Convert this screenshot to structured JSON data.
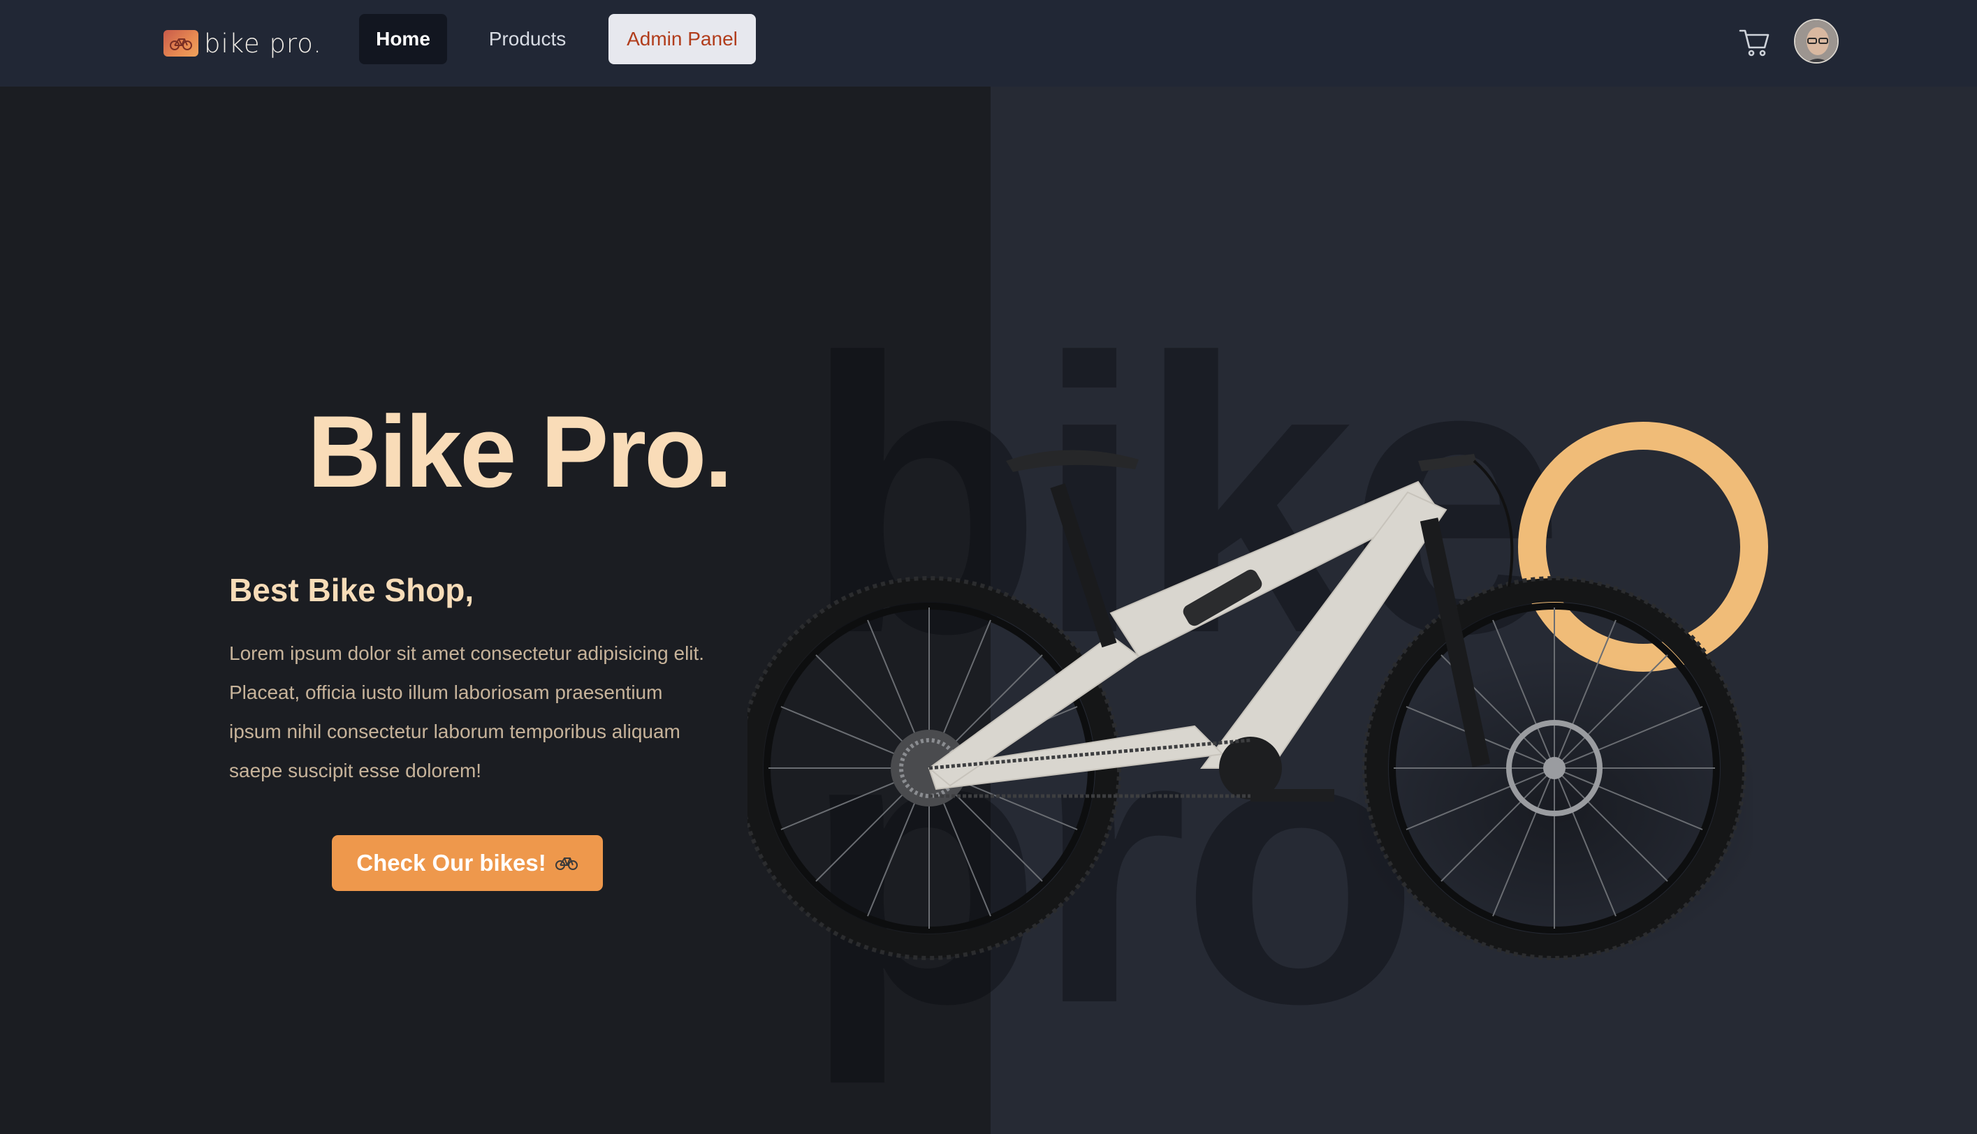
{
  "brand": {
    "name": "bike pro.",
    "logo_icon": "bicycle-icon"
  },
  "nav": {
    "home": "Home",
    "products": "Products",
    "admin": "Admin Panel"
  },
  "header_icons": {
    "cart": "cart-icon",
    "avatar": "user-avatar"
  },
  "hero": {
    "title": "Bike Pro.",
    "subtitle": "Best Bike Shop,",
    "body": "Lorem ipsum dolor sit amet consectetur adipisicing elit. Placeat, officia iusto illum laboriosam praesentium ipsum nihil consectetur laborum temporibus aliquam saepe suscipit esse dolorem!",
    "cta_label": "Check Our bikes!",
    "cta_icon": "bicycle-icon",
    "watermark_top": "bike",
    "watermark_bottom": "pro"
  },
  "colors": {
    "accent": "#ee984c",
    "title": "#f9dcb8",
    "ring": "#f0bc78",
    "nav_bg": "#212735"
  }
}
